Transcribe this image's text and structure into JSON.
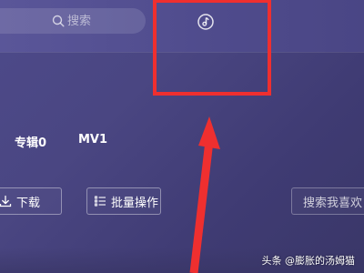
{
  "search": {
    "placeholder": "搜索"
  },
  "tabs": {
    "album_label": "专辑0",
    "mv_label": "MV1"
  },
  "toolbar": {
    "download_label": "下载",
    "batch_label": "批量操作",
    "search_fav_label": "搜索我喜欢"
  },
  "watermark": {
    "text": "头条 @膨胀的汤姆猫"
  },
  "colors": {
    "background": "#4a4682",
    "highlight": "#ef2f2f",
    "arrow": "#ef2f2f"
  }
}
